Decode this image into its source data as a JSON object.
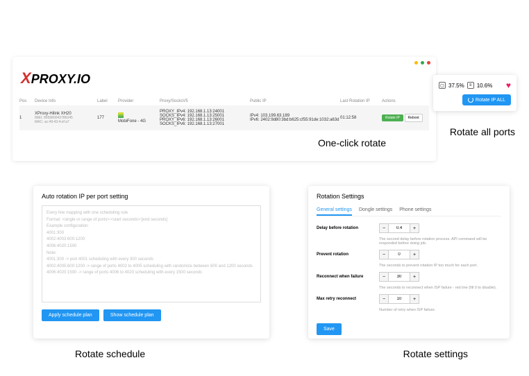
{
  "logo": "PROXY.IO",
  "table": {
    "headers": {
      "pos": "Pos",
      "dev": "Device Info",
      "lab": "Label",
      "prov": "Provider",
      "px": "Proxy/SocksV5",
      "ip": "Public IP",
      "rot": "Last Rotation IP",
      "act": "Actions"
    },
    "row": {
      "pos": "1",
      "dev_name": "XProxy-Hilink XH20",
      "dev_imei": "IMEI: 866980043786345",
      "dev_mac": "MAC: ac:49:43:4:ef:a7",
      "label": "177",
      "provider": "MobiFone - 4G",
      "px1": "PROXY_IPv4: 192.168.1.13:24001",
      "px2": "SOCKS_IPv4: 192.168.1.13:25001",
      "px3": "PROXY_IPv6: 192.168.1.13:26001",
      "px4": "SOCKS_IPv6: 192.168.1.13:27001",
      "ip1": "IPv4: 103.199.63.189",
      "ip2": "IPv6: 2402:9d80:3bd:b625:cf55:91de:1032:a63d",
      "rot": "01:12:58",
      "btn_rotate": "Rotate IP",
      "btn_reboot": "Reboot"
    }
  },
  "top": {
    "cpu": "37.5%",
    "cpu_ico": "▢",
    "mem": "10.6%",
    "mem_ico": "≡",
    "btn": "Rotate IP ALL"
  },
  "annotations": {
    "a1": "One-click rotate",
    "a2": "Rotate all ports",
    "a3": "Rotate schedule",
    "a4": "Rotate settings"
  },
  "panel_left": {
    "title": "Auto rotation IP per port setting",
    "placeholder": "Every line mapping with one scheduling rule\nFormat: <single or range of ports>:<start seconds>:[end seconds]\nExample configuration:\n   4001:300\n   4002:4003:600:1200\n   4006:4020:1500\nNote:\n   4001:300 -> port 4001 scheduling with every 300 seconds\n   4002:4005:600:1200 -> range of ports 4002 to 4005 scheduling with randomize between 600 and 1200 seconds\n   4006:4020:1500 -> range of ports 4006 to 4020 scheduling with every 1500 seconds",
    "btn_apply": "Apply schedule plan",
    "btn_show": "Show schedule plan"
  },
  "panel_right": {
    "title": "Rotation Settings",
    "tabs": {
      "general": "General settings",
      "dongle": "Dongle settings",
      "phone": "Phone settings"
    },
    "fields": {
      "delay": {
        "label": "Delay before rotation",
        "val": "0.4",
        "hint": "The second delay before rotation process. API command will be responded before doing job."
      },
      "prevent": {
        "label": "Prevent rotation",
        "val": "0",
        "hint": "The seconds to prevent rotation IP too much for each port."
      },
      "reconnect": {
        "label": "Reconnect when failure",
        "val": "30",
        "hint": "The seconds to reconnect when ISP failure - red line (fill 0 to disable)."
      },
      "retry": {
        "label": "Max retry reconnect",
        "val": "10",
        "hint": "Number of retry when ISP failure."
      }
    },
    "btn_save": "Save"
  }
}
